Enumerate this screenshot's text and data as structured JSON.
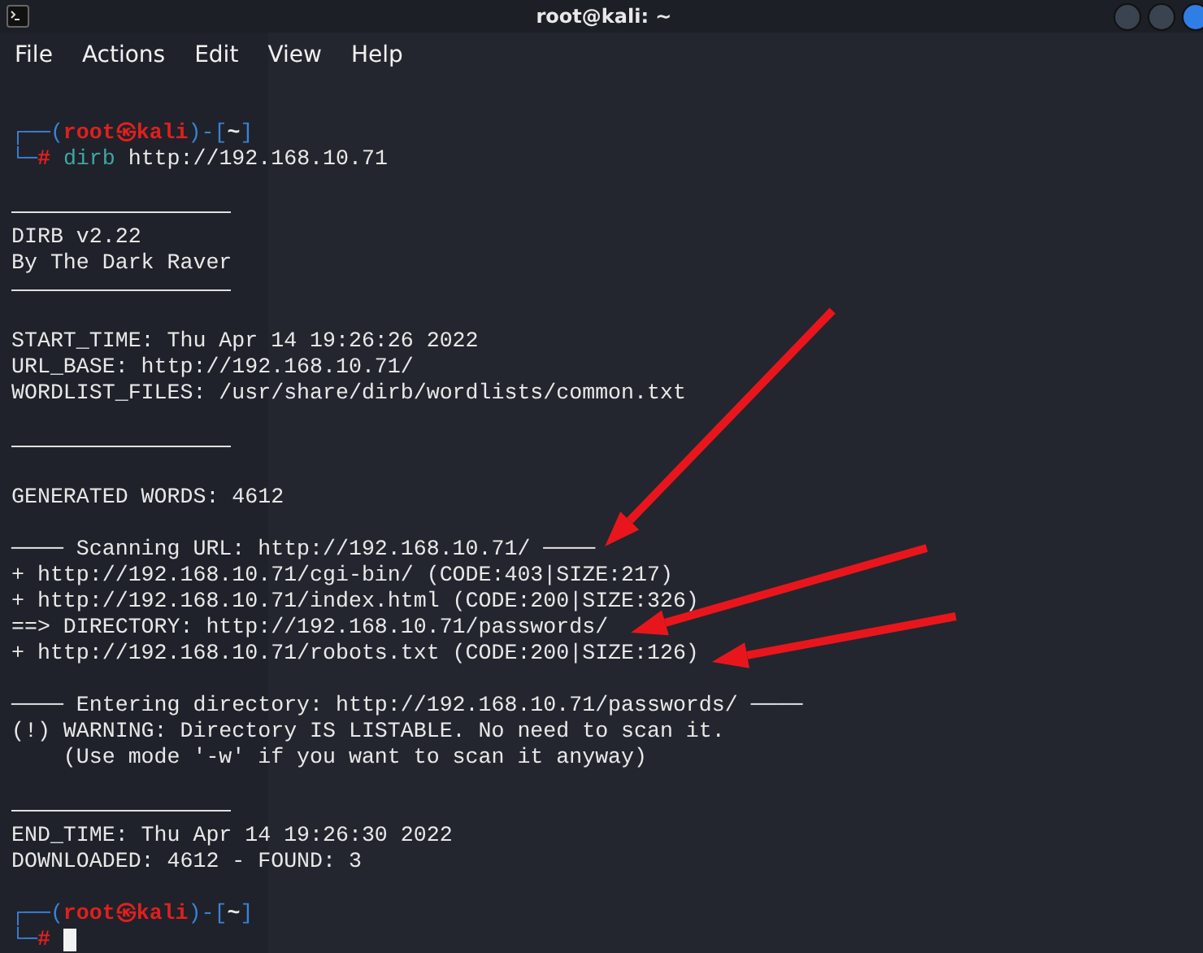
{
  "window": {
    "title": "root@kali: ~"
  },
  "menu": [
    "File",
    "Actions",
    "Edit",
    "View",
    "Help"
  ],
  "lines": [
    {
      "kind": "blank"
    },
    {
      "kind": "prompt",
      "open": "┌──(",
      "user": "root",
      "at": "㉿",
      "host": "kali",
      "close": ")-[",
      "cwd": "~",
      "end": "]",
      "corner": "└─",
      "symbol": "#",
      "program": "dirb",
      "args": "http://192.168.10.71",
      "cursor": false
    },
    {
      "kind": "blank"
    },
    {
      "kind": "rule"
    },
    {
      "kind": "text",
      "text": "DIRB v2.22"
    },
    {
      "kind": "text",
      "text": "By The Dark Raver"
    },
    {
      "kind": "rule"
    },
    {
      "kind": "blank"
    },
    {
      "kind": "text",
      "text": "START_TIME: Thu Apr 14 19:26:26 2022"
    },
    {
      "kind": "text",
      "text": "URL_BASE: http://192.168.10.71/"
    },
    {
      "kind": "text",
      "text": "WORDLIST_FILES: /usr/share/dirb/wordlists/common.txt"
    },
    {
      "kind": "blank"
    },
    {
      "kind": "rule"
    },
    {
      "kind": "blank"
    },
    {
      "kind": "text",
      "text": "GENERATED WORDS: 4612"
    },
    {
      "kind": "blank"
    },
    {
      "kind": "text",
      "text": "──── Scanning URL: http://192.168.10.71/ ────",
      "arrow": true
    },
    {
      "kind": "text",
      "text": "+ http://192.168.10.71/cgi-bin/ (CODE:403|SIZE:217)"
    },
    {
      "kind": "text",
      "text": "+ http://192.168.10.71/index.html (CODE:200|SIZE:326)"
    },
    {
      "kind": "text",
      "text": "==> DIRECTORY: http://192.168.10.71/passwords/",
      "arrow": true
    },
    {
      "kind": "text",
      "text": "+ http://192.168.10.71/robots.txt (CODE:200|SIZE:126)",
      "arrow": true
    },
    {
      "kind": "blank"
    },
    {
      "kind": "text",
      "text": "──── Entering directory: http://192.168.10.71/passwords/ ────"
    },
    {
      "kind": "text",
      "text": "(!) WARNING: Directory IS LISTABLE. No need to scan it."
    },
    {
      "kind": "text",
      "text": "    (Use mode '-w' if you want to scan it anyway)"
    },
    {
      "kind": "blank"
    },
    {
      "kind": "rule"
    },
    {
      "kind": "text",
      "text": "END_TIME: Thu Apr 14 19:26:30 2022"
    },
    {
      "kind": "text",
      "text": "DOWNLOADED: 4612 - FOUND: 3"
    },
    {
      "kind": "blank"
    },
    {
      "kind": "prompt",
      "open": "┌──(",
      "user": "root",
      "at": "㉿",
      "host": "kali",
      "close": ")-[",
      "cwd": "~",
      "end": "]",
      "corner": "└─",
      "symbol": "#",
      "cursor": true
    }
  ]
}
